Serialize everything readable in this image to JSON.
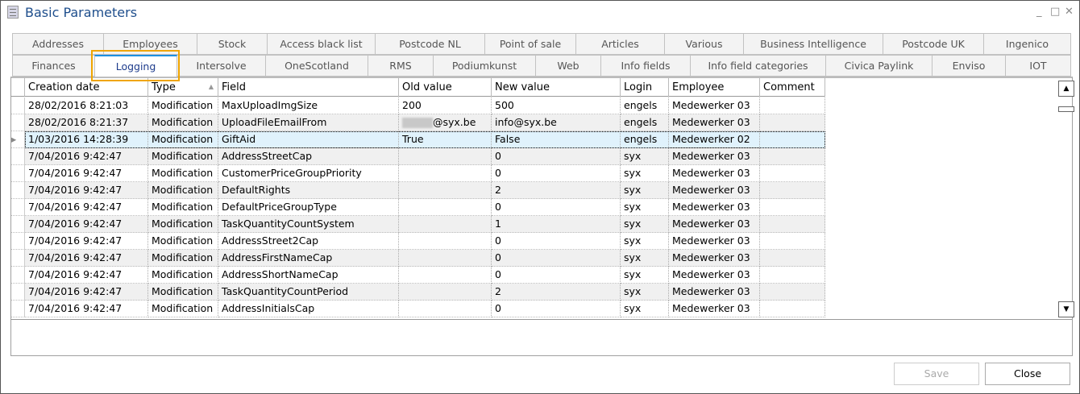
{
  "window": {
    "title": "Basic Parameters",
    "minimize": "_",
    "maximize": "□",
    "close": "✕"
  },
  "tabs_row1": [
    "Addresses",
    "Employees",
    "Stock",
    "Access black list",
    "Postcode NL",
    "Point of sale",
    "Articles",
    "Various",
    "Business Intelligence",
    "Postcode UK",
    "Ingenico"
  ],
  "tabs_row2": [
    "Finances",
    "Logging",
    "Intersolve",
    "OneScotland",
    "RMS",
    "Podiumkunst",
    "Web",
    "Info fields",
    "Info field categories",
    "Civica Paylink",
    "Enviso",
    "IOT"
  ],
  "active_tab": "Logging",
  "columns": [
    "Creation date",
    "Type",
    "Field",
    "Old value",
    "New value",
    "Login",
    "Employee",
    "Comment"
  ],
  "rows": [
    [
      "28/02/2016 8:21:03",
      "Modification",
      "MaxUploadImgSize",
      "200",
      "500",
      "engels",
      "Medewerker 03",
      ""
    ],
    [
      "28/02/2016 8:21:37",
      "Modification",
      "UploadFileEmailFrom",
      "@syx.be",
      "info@syx.be",
      "engels",
      "Medewerker 03",
      ""
    ],
    [
      "1/03/2016 14:28:39",
      "Modification",
      "GiftAid",
      "True",
      "False",
      "engels",
      "Medewerker 02",
      ""
    ],
    [
      "7/04/2016 9:42:47",
      "Modification",
      "AddressStreetCap",
      "",
      "0",
      "syx",
      "Medewerker 03",
      ""
    ],
    [
      "7/04/2016 9:42:47",
      "Modification",
      "CustomerPriceGroupPriority",
      "",
      "0",
      "syx",
      "Medewerker 03",
      ""
    ],
    [
      "7/04/2016 9:42:47",
      "Modification",
      "DefaultRights",
      "",
      "2",
      "syx",
      "Medewerker 03",
      ""
    ],
    [
      "7/04/2016 9:42:47",
      "Modification",
      "DefaultPriceGroupType",
      "",
      "0",
      "syx",
      "Medewerker 03",
      ""
    ],
    [
      "7/04/2016 9:42:47",
      "Modification",
      "TaskQuantityCountSystem",
      "",
      "1",
      "syx",
      "Medewerker 03",
      ""
    ],
    [
      "7/04/2016 9:42:47",
      "Modification",
      "AddressStreet2Cap",
      "",
      "0",
      "syx",
      "Medewerker 03",
      ""
    ],
    [
      "7/04/2016 9:42:47",
      "Modification",
      "AddressFirstNameCap",
      "",
      "0",
      "syx",
      "Medewerker 03",
      ""
    ],
    [
      "7/04/2016 9:42:47",
      "Modification",
      "AddressShortNameCap",
      "",
      "0",
      "syx",
      "Medewerker 03",
      ""
    ],
    [
      "7/04/2016 9:42:47",
      "Modification",
      "TaskQuantityCountPeriod",
      "",
      "2",
      "syx",
      "Medewerker 03",
      ""
    ],
    [
      "7/04/2016 9:42:47",
      "Modification",
      "AddressInitialsCap",
      "",
      "0",
      "syx",
      "Medewerker 03",
      ""
    ]
  ],
  "selected_row": 2,
  "buttons": {
    "save": "Save",
    "close": "Close"
  },
  "colors": {
    "accent": "#1e90e0",
    "highlight": "#f0a500",
    "selected_row": "#e0f2fc"
  }
}
